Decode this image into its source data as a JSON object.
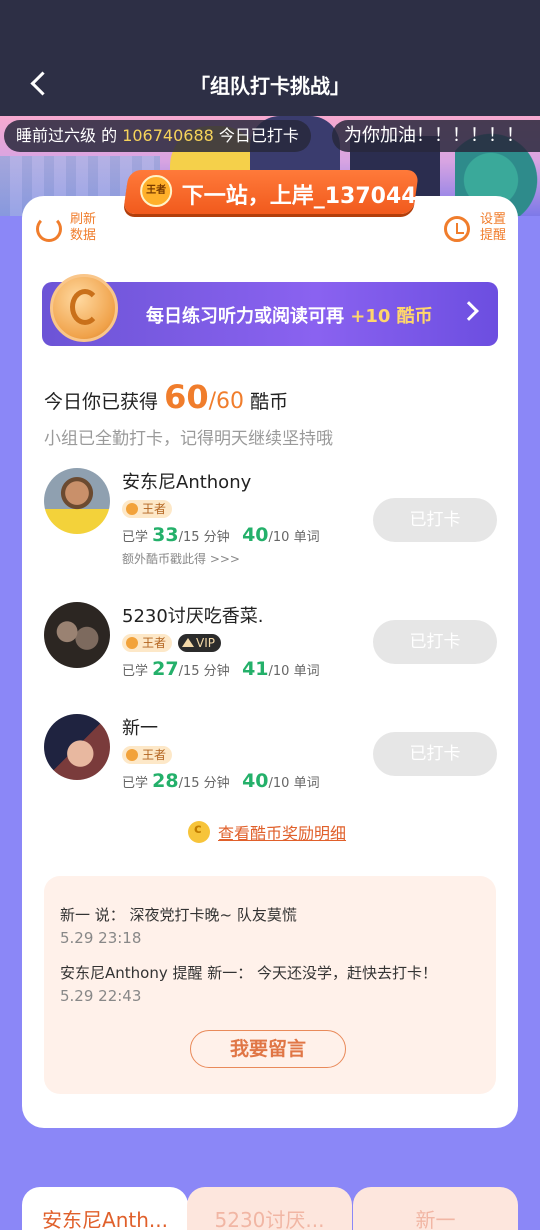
{
  "header": {
    "title": "「组队打卡挑战」"
  },
  "ticker": {
    "left_prefix": "睡前过六级 的 ",
    "left_number": "106740688",
    "left_suffix": " 今日已打卡",
    "right_text": "为你加油！！！！！！"
  },
  "team": {
    "badge": "王者",
    "name": "下一站，上岸_137044"
  },
  "actions": {
    "refresh": "刷新数据",
    "remind": "设置提醒"
  },
  "promo": {
    "text": "每日练习听力或阅读可再",
    "bonus": "+10 酷币"
  },
  "earned": {
    "prefix": "今日你已获得",
    "value": "60",
    "total": "60",
    "unit": "酷币",
    "subtitle": "小组已全勤打卡，记得明天继续坚持哦"
  },
  "members": [
    {
      "name": "安东尼Anthony",
      "tags": [
        "王者"
      ],
      "study_label": "已学",
      "minutes": "33",
      "minutes_goal": "/15 分钟",
      "words": "40",
      "words_goal": "/10 单词",
      "extra": "额外酷币戳此得 >>>",
      "status": "已打卡"
    },
    {
      "name": "5230讨厌吃香菜.",
      "tags": [
        "王者",
        "VIP"
      ],
      "study_label": "已学",
      "minutes": "27",
      "minutes_goal": "/15 分钟",
      "words": "41",
      "words_goal": "/10 单词",
      "status": "已打卡"
    },
    {
      "name": "新一",
      "tags": [
        "王者"
      ],
      "study_label": "已学",
      "minutes": "28",
      "minutes_goal": "/15 分钟",
      "words": "40",
      "words_goal": "/10 单词",
      "status": "已打卡"
    }
  ],
  "reward_link": "查看酷币奖励明细",
  "messages": [
    {
      "text": "新一 说： 深夜党打卡晚~ 队友莫慌",
      "time": "5.29 23:18"
    },
    {
      "text": "安东尼Anthony 提醒 新一： 今天还没学，赶快去打卡！",
      "time": "5.29 22:43"
    }
  ],
  "leave_message": "我要留言",
  "tabs": [
    "安东尼Anth...",
    "5230讨厌...",
    "新一"
  ]
}
